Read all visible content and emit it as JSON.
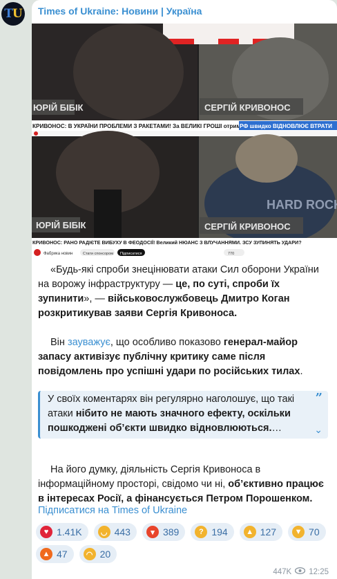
{
  "channel": {
    "avatar_t": "T",
    "avatar_u": "U",
    "name": "Times of Ukraine: Новини | Україна"
  },
  "media": {
    "top_left_name": "ЮРІЙ БІБІК",
    "top_right_name": "СЕРГІЙ КРИВОНОС",
    "top_ticker": "КРИВОНОС: В УКРАЇНИ ПРОБЛЕМИ З РАКЕТАМИ! За ВЕЛИКІ ГРОШІ отримали НЕ ТЕ.",
    "top_ticker_highlight": "РФ швидко ВІДНОВЛЮЄ ВТРАТИ",
    "bottom_left_name": "ЮРІЙ БІБІК",
    "bottom_right_name": "СЕРГІЙ КРИВОНОС",
    "bottom_ticker": "КРИВОНОС: РАНО РАДІЄТЕ ВИБУХУ В ФЕОДОСІЇ! Великий НЮАНС З ВЛУЧАННЯМИ. ЗСУ ЗУПИНЯТЬ УДАРИ?",
    "shirt_text": "HARD ROCK",
    "yt_channel": "Фабрика новин",
    "yt_sponsor": "Стати спонсором",
    "yt_subscribe": "Підписатися",
    "yt_likes": "770"
  },
  "body": {
    "p1_a": "«Будь-які спроби знецінювати атаки Сил оборони України на ворожу інфраструктуру — ",
    "p1_b": "це, по суті, спроби їх зупинити",
    "p1_c": "», — ",
    "p1_d": "військовослужбовець Дмитро Коган розкритикував заяви Сергія Кривоноса.",
    "p2_a": "Він ",
    "p2_link": "зауважує",
    "p2_b": ", що особливо показово ",
    "p2_c": "генерал-майор запасу активізує публічну критику саме після повідомлень про успішні удари по російських тилах",
    "p2_d": ".",
    "quote_a": "У своїх коментарях він регулярно наголошує, що такі атаки ",
    "quote_b": "нібито не мають значного ефекту, оскільки пошкоджені об’єкти швидко відновлюються.",
    "quote_ellipsis": "…",
    "p3_a": "На його думку, діяльність Сергія Кривоноса в інформаційному просторі, свідомо чи ні, ",
    "p3_b": "об’єктивно працює в інтересах Росії, а фінансується Петром Порошенком."
  },
  "subscribe_link": "Підписатися на Times of Ukraine",
  "reactions": [
    {
      "icon": "heart-icon",
      "glyph": "♥",
      "count": "1.41K",
      "color": "#e0243a"
    },
    {
      "icon": "grin-icon",
      "glyph": "◡",
      "count": "443",
      "color": "#f2b32e"
    },
    {
      "icon": "angry-icon",
      "glyph": "▾",
      "count": "389",
      "color": "#e8452c"
    },
    {
      "icon": "thinking-icon",
      "glyph": "?",
      "count": "194",
      "color": "#f2b32e"
    },
    {
      "icon": "thumbs-up-icon",
      "glyph": "▲",
      "count": "127",
      "color": "#f2b32e"
    },
    {
      "icon": "thumbs-down-icon",
      "glyph": "▼",
      "count": "70",
      "color": "#f2b32e"
    },
    {
      "icon": "fire-icon",
      "glyph": "▲",
      "count": "47",
      "color": "#f06a1d"
    },
    {
      "icon": "crying-icon",
      "glyph": "◠",
      "count": "20",
      "color": "#f2b32e"
    }
  ],
  "views": "447K",
  "time": "12:25",
  "colors": {
    "accent": "#3a8fd1",
    "background": "#dfe5e0"
  }
}
